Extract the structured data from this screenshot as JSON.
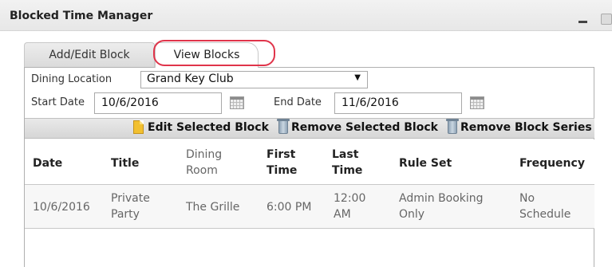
{
  "window": {
    "title": "Blocked Time Manager"
  },
  "tabs": [
    {
      "label": "Add/Edit Block",
      "active": false
    },
    {
      "label": "View Blocks",
      "active": true
    }
  ],
  "filters": {
    "dining_location_label": "Dining Location",
    "dining_location_value": "Grand Key Club",
    "start_date_label": "Start Date",
    "start_date_value": "10/6/2016",
    "end_date_label": "End Date",
    "end_date_value": "11/6/2016"
  },
  "toolbar": {
    "edit_label": "Edit Selected Block",
    "remove_label": "Remove Selected Block",
    "remove_series_label": "Remove Block Series"
  },
  "table": {
    "headers": {
      "date": "Date",
      "title": "Title",
      "dining_room_1": "Dining",
      "dining_room_2": "Room",
      "first_time_1": "First",
      "first_time_2": "Time",
      "last_time_1": "Last",
      "last_time_2": "Time",
      "rule_set": "Rule Set",
      "frequency": "Frequency"
    },
    "rows": [
      {
        "date": "10/6/2016",
        "title_1": "Private",
        "title_2": "Party",
        "dining_room": "The Grille",
        "first_time": "6:00 PM",
        "last_time_1": "12:00",
        "last_time_2": "AM",
        "rule_set_1": "Admin Booking",
        "rule_set_2": "Only",
        "frequency_1": "No",
        "frequency_2": "Schedule"
      }
    ]
  },
  "colors": {
    "highlight": "#e0344a"
  },
  "icons": {
    "edit": "document-icon",
    "remove": "trash-icon",
    "remove_series": "trash-icon",
    "date_picker": "calendar-icon"
  }
}
